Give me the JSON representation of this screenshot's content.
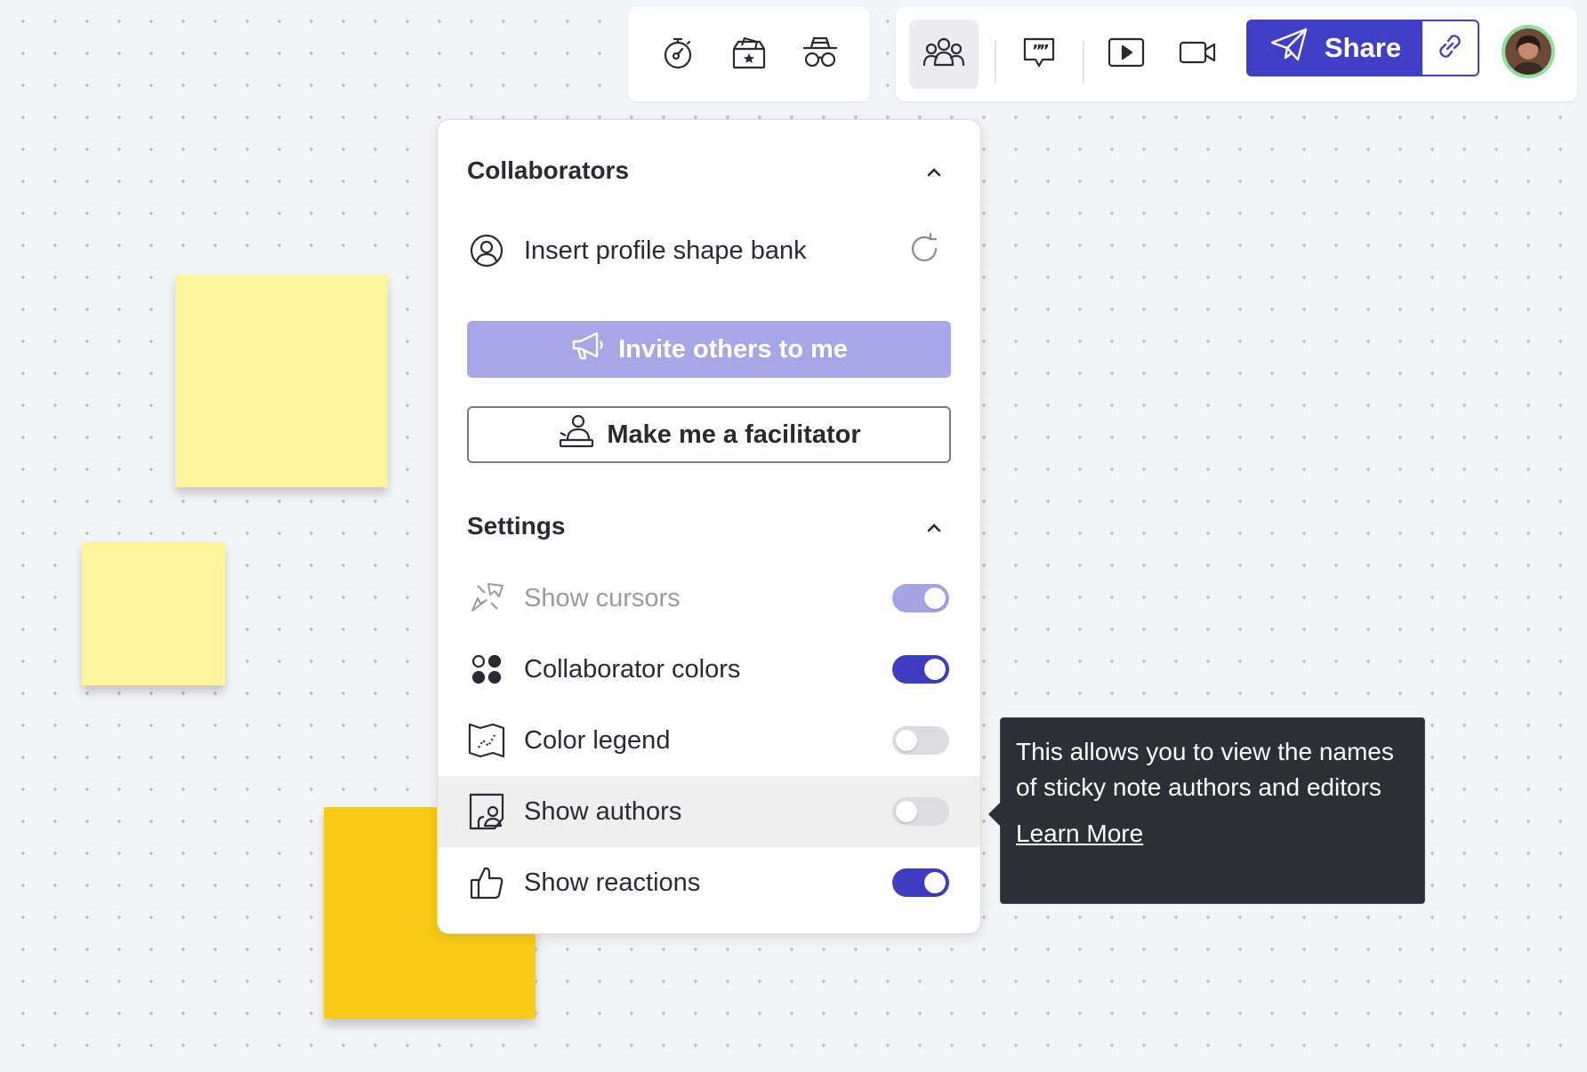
{
  "toolbar": {
    "left_group": [
      {
        "icon": "timer-icon"
      },
      {
        "icon": "ballot-box-icon"
      },
      {
        "icon": "private-mode-icon"
      }
    ],
    "right_group": [
      {
        "icon": "collaborators-icon",
        "active": true
      },
      {
        "icon": "comment-icon"
      },
      {
        "icon": "present-icon"
      },
      {
        "icon": "video-icon"
      }
    ],
    "share_label": "Share",
    "link_icon": "link-icon",
    "avatar_icon": "user-avatar"
  },
  "panel": {
    "collaborators": {
      "title": "Collaborators",
      "insert_label": "Insert profile shape bank",
      "invite_label": "Invite others to me",
      "facilitator_label": "Make me a facilitator"
    },
    "settings": {
      "title": "Settings",
      "rows": [
        {
          "label": "Show cursors",
          "state": "on-disabled"
        },
        {
          "label": "Collaborator colors",
          "state": "on"
        },
        {
          "label": "Color legend",
          "state": "off"
        },
        {
          "label": "Show authors",
          "state": "off"
        },
        {
          "label": "Show reactions",
          "state": "on"
        }
      ]
    }
  },
  "tooltip": {
    "text": "This allows you to view the names of sticky note authors and editors",
    "link": "Learn More"
  },
  "colors": {
    "accent": "#3f3fc7",
    "accent_disabled": "#a7a7e6",
    "sticky_light": "#fdf59c",
    "sticky_dark": "#f8cb16",
    "tooltip_bg": "#2c2f36"
  }
}
